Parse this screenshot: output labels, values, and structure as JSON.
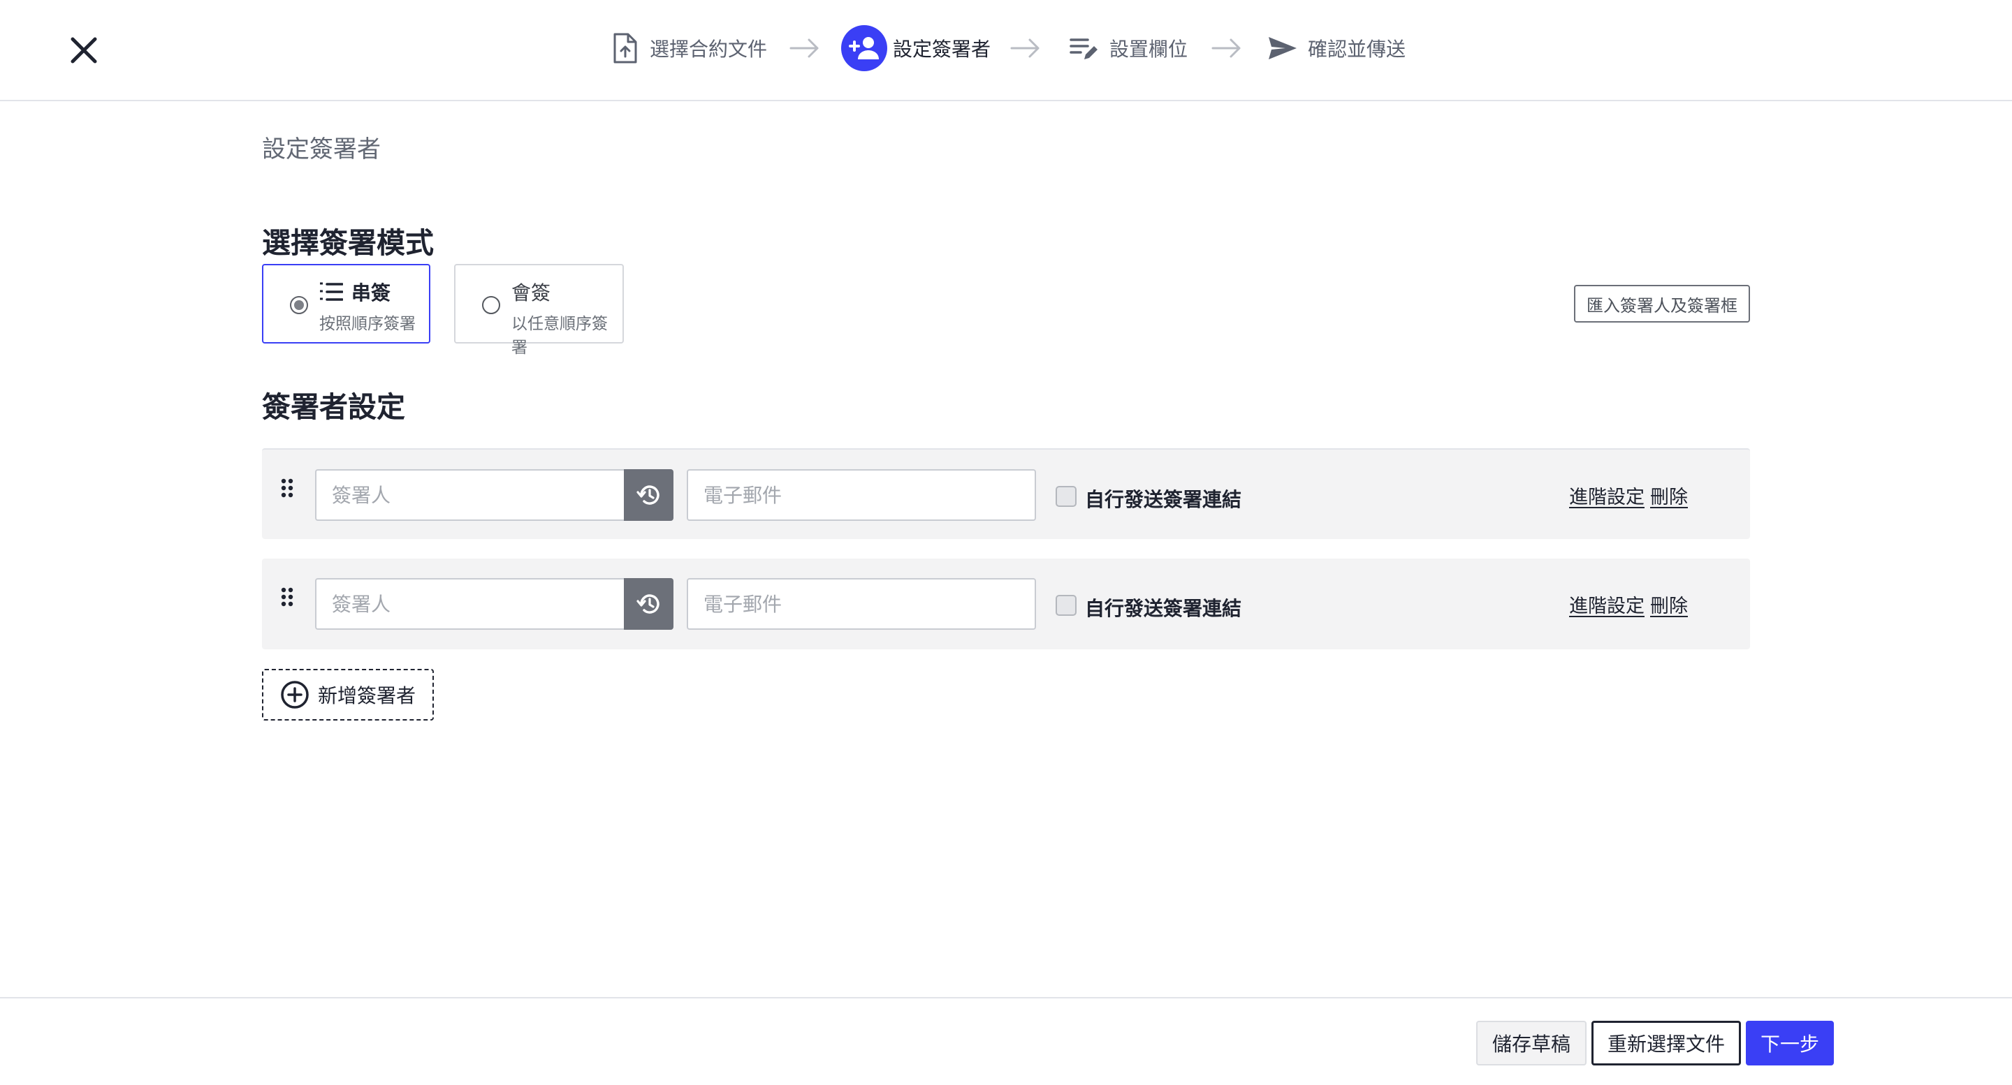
{
  "header": {
    "steps": [
      {
        "label": "選擇合約文件",
        "icon": "file-upload-icon",
        "state": "done"
      },
      {
        "label": "設定簽署者",
        "icon": "add-person-icon",
        "state": "active"
      },
      {
        "label": "設置欄位",
        "icon": "edit-fields-icon",
        "state": "pending"
      },
      {
        "label": "確認並傳送",
        "icon": "send-icon",
        "state": "pending"
      }
    ],
    "accent_color": "#3a3ff5"
  },
  "main": {
    "page_subtitle": "設定簽署者",
    "mode_section_title": "選擇簽署模式",
    "modes": [
      {
        "title": "串簽",
        "desc": "按照順序簽署",
        "selected": true,
        "icon": "ordered-list-icon"
      },
      {
        "title": "會簽",
        "desc": "以任意順序簽署",
        "selected": false
      }
    ],
    "import_button": "匯入簽署人及簽署框",
    "signer_section_title": "簽署者設定",
    "signers": [
      {
        "name_placeholder": "簽署人",
        "email_placeholder": "電子郵件",
        "self_send_label": "自行發送簽署連結",
        "self_send_checked": false,
        "advanced_label": "進階設定",
        "delete_label": "刪除"
      },
      {
        "name_placeholder": "簽署人",
        "email_placeholder": "電子郵件",
        "self_send_label": "自行發送簽署連結",
        "self_send_checked": false,
        "advanced_label": "進階設定",
        "delete_label": "刪除"
      }
    ],
    "add_signer_label": "新增簽署者"
  },
  "footer": {
    "save_draft": "儲存草稿",
    "reselect_file": "重新選擇文件",
    "next": "下一步"
  }
}
